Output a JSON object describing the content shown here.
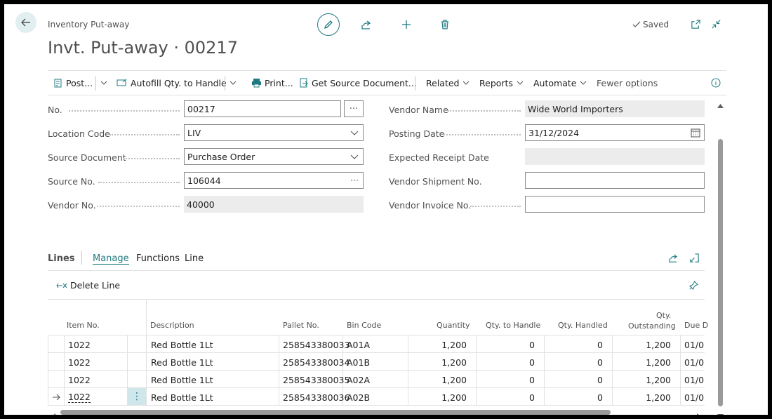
{
  "header": {
    "breadcrumb": "Inventory Put-away",
    "title": "Invt. Put-away · 00217",
    "saved_label": "Saved"
  },
  "actions": {
    "post": "Post...",
    "autofill": "Autofill Qty. to Handle",
    "print": "Print...",
    "get_source": "Get Source Document...",
    "related": "Related",
    "reports": "Reports",
    "automate": "Automate",
    "fewer": "Fewer options"
  },
  "general": {
    "no": {
      "label": "No.",
      "value": "00217"
    },
    "location": {
      "label": "Location Code",
      "value": "LIV"
    },
    "source_document": {
      "label": "Source Document",
      "value": "Purchase Order"
    },
    "source_no": {
      "label": "Source No.",
      "value": "106044"
    },
    "vendor_no": {
      "label": "Vendor No.",
      "value": "40000"
    },
    "vendor_name": {
      "label": "Vendor Name",
      "value": "Wide World Importers"
    },
    "posting_date": {
      "label": "Posting Date",
      "value": "31/12/2024"
    },
    "expected_receipt": {
      "label": "Expected Receipt Date",
      "value": ""
    },
    "vendor_shipment": {
      "label": "Vendor Shipment No.",
      "value": ""
    },
    "vendor_invoice": {
      "label": "Vendor Invoice No.",
      "value": ""
    }
  },
  "lines": {
    "title": "Lines",
    "tabs": [
      "Manage",
      "Functions",
      "Line"
    ],
    "delete_line": "Delete Line",
    "columns": {
      "item_no": "Item No.",
      "description": "Description",
      "pallet_no": "Pallet No.",
      "bin_code": "Bin Code",
      "quantity": "Quantity",
      "qty_to_handle": "Qty. to Handle",
      "qty_handled": "Qty. Handled",
      "qty_outstanding_1": "Qty.",
      "qty_outstanding_2": "Outstanding",
      "due_date": "Due D"
    },
    "rows": [
      {
        "item_no": "1022",
        "description": "Red Bottle 1Lt",
        "pallet_no": "258543380033",
        "bin_code": "A01A",
        "quantity": "1,200",
        "qty_to_handle": "0",
        "qty_handled": "0",
        "qty_outstanding": "1,200",
        "due_date": "01/0"
      },
      {
        "item_no": "1022",
        "description": "Red Bottle 1Lt",
        "pallet_no": "258543380034",
        "bin_code": "A01B",
        "quantity": "1,200",
        "qty_to_handle": "0",
        "qty_handled": "0",
        "qty_outstanding": "1,200",
        "due_date": "01/0"
      },
      {
        "item_no": "1022",
        "description": "Red Bottle 1Lt",
        "pallet_no": "258543380035",
        "bin_code": "A02A",
        "quantity": "1,200",
        "qty_to_handle": "0",
        "qty_handled": "0",
        "qty_outstanding": "1,200",
        "due_date": "01/0"
      },
      {
        "item_no": "1022",
        "description": "Red Bottle 1Lt",
        "pallet_no": "258543380036",
        "bin_code": "A02B",
        "quantity": "1,200",
        "qty_to_handle": "0",
        "qty_handled": "0",
        "qty_outstanding": "1,200",
        "due_date": "01/0"
      }
    ]
  },
  "colors": {
    "accent": "#1f7a80",
    "readonly_bg": "#ececec",
    "selected_cell": "#cfe7ea"
  }
}
